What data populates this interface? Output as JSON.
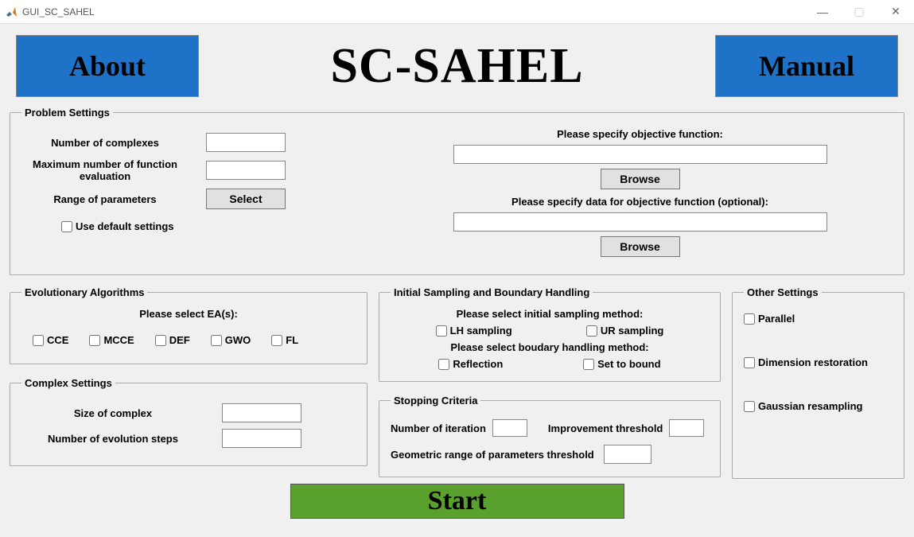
{
  "window": {
    "title": "GUI_SC_SAHEL",
    "minimize": "—",
    "maximize": "▢",
    "close": "✕"
  },
  "header": {
    "about": "About",
    "title": "SC-SAHEL",
    "manual": "Manual"
  },
  "problem": {
    "legend": "Problem Settings",
    "num_complexes_label": "Number of complexes",
    "num_complexes_value": "",
    "max_eval_label": "Maximum number of function evaluation",
    "max_eval_value": "",
    "range_label": "Range of parameters",
    "select_btn": "Select",
    "default_label": "Use default settings",
    "obj_label": "Please specify objective function:",
    "obj_value": "",
    "browse1": "Browse",
    "data_label": "Please specify data for objective function (optional):",
    "data_value": "",
    "browse2": "Browse"
  },
  "ea": {
    "legend": "Evolutionary Algorithms",
    "prompt": "Please select EA(s):",
    "items": [
      {
        "label": "CCE"
      },
      {
        "label": "MCCE"
      },
      {
        "label": "DEF"
      },
      {
        "label": "GWO"
      },
      {
        "label": "FL"
      }
    ]
  },
  "complex": {
    "legend": "Complex Settings",
    "size_label": "Size of complex",
    "size_value": "",
    "steps_label": "Number of evolution steps",
    "steps_value": ""
  },
  "sampling": {
    "legend": "Initial Sampling and Boundary Handling",
    "init_prompt": "Please select initial sampling method:",
    "lh": "LH sampling",
    "ur": "UR sampling",
    "bh_prompt": "Please select boudary handling method:",
    "reflection": "Reflection",
    "set_bound": "Set to bound"
  },
  "stopping": {
    "legend": "Stopping Criteria",
    "iter_label": "Number of iteration",
    "iter_value": "",
    "imp_label": "Improvement threshold",
    "imp_value": "",
    "geo_label": "Geometric range of parameters threshold",
    "geo_value": ""
  },
  "other": {
    "legend": "Other Settings",
    "parallel": "Parallel",
    "dim": "Dimension restoration",
    "gauss": "Gaussian resampling"
  },
  "start": "Start"
}
